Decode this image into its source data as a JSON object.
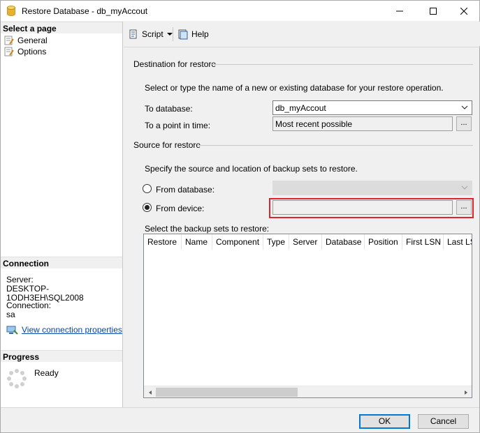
{
  "window": {
    "title": "Restore Database - db_myAccout"
  },
  "left": {
    "select_page_header": "Select a page",
    "pages": [
      {
        "label": "General",
        "icon": "page-wrench-icon"
      },
      {
        "label": "Options",
        "icon": "page-wrench-icon"
      }
    ],
    "connection_header": "Connection",
    "server_label": "Server:",
    "server_value": "DESKTOP-1ODH3EH\\SQL2008",
    "connection_label": "Connection:",
    "connection_value": "sa",
    "view_props_link": "View connection properties",
    "progress_header": "Progress",
    "progress_status": "Ready"
  },
  "toolbar": {
    "script_label": "Script",
    "help_label": "Help"
  },
  "destination": {
    "group_title": "Destination for restore",
    "description": "Select or type the name of a new or existing database for your restore operation.",
    "to_database_label": "To database:",
    "to_database_value": "db_myAccout",
    "point_in_time_label": "To a point in time:",
    "point_in_time_value": "Most recent possible",
    "browse_label": "..."
  },
  "source": {
    "group_title": "Source for restore",
    "description": "Specify the source and location of backup sets to restore.",
    "from_database_label": "From database:",
    "from_device_label": "From device:",
    "from_device_value": "",
    "browse_label": "...",
    "selected_option": "From device:"
  },
  "backup_sets": {
    "label": "Select the backup sets to restore:",
    "columns": [
      "Restore",
      "Name",
      "Component",
      "Type",
      "Server",
      "Database",
      "Position",
      "First LSN",
      "Last LSN"
    ]
  },
  "buttons": {
    "ok": "OK",
    "cancel": "Cancel"
  },
  "colors": {
    "highlight": "#e0242a",
    "link": "#0645ad",
    "default_button_border": "#0078d7"
  }
}
